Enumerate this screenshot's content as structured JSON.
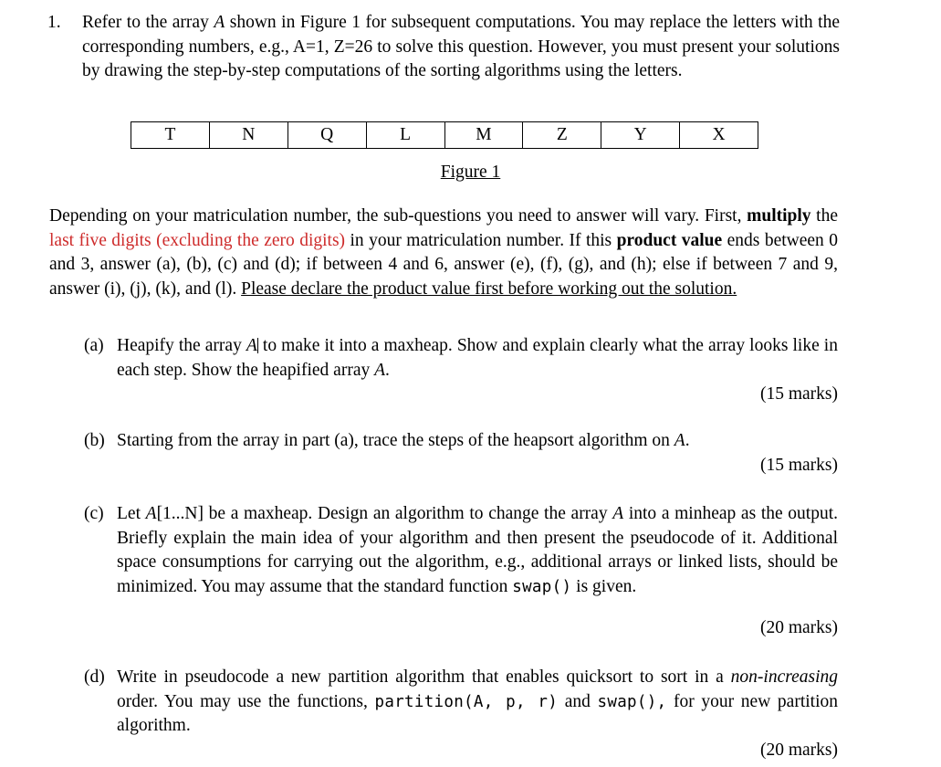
{
  "question": {
    "number": "1.",
    "intro_part1": "Refer to the array ",
    "intro_var": "A",
    "intro_part2": " shown in Figure 1 for subsequent computations. You may replace the letters with the corresponding numbers, e.g., A=1, Z=26 to solve this question. However, you must present your solutions by drawing the step-by-step computations of the sorting algorithms using the letters."
  },
  "figure": {
    "cells": [
      "T",
      "N",
      "Q",
      "L",
      "M",
      "Z",
      "Y",
      "X"
    ],
    "caption": "Figure 1"
  },
  "matriculation": {
    "seg1": "Depending on your matriculation number, the sub-questions you need to answer will vary. First, ",
    "bold1": "multiply",
    "seg2": " the ",
    "red1": "last five digits (excluding the zero digits)",
    "seg3": " in your matriculation number. If this ",
    "bold2": "product value",
    "seg4": " ends between 0 and 3, answer (a), (b), (c) and (d); if between 4 and 6, answer (e), (f), (g), and (h); else if between 7 and 9, answer (i), (j), (k), and (l). ",
    "underlined": "Please declare the product value first before working out the solution."
  },
  "parts": [
    {
      "label": "(a)",
      "seg1": "Heapify the array ",
      "var1": "A",
      "seg2": " to make it into a maxheap. Show and explain clearly what the array looks like in each step. Show the heapified array ",
      "var2": "A",
      "seg3": ".",
      "marks": "(15 marks)"
    },
    {
      "label": "(b)",
      "seg1": "Starting from the array in part (a), trace the steps of the heapsort algorithm on ",
      "var1": "A",
      "seg2": ".",
      "marks": "(15 marks)"
    },
    {
      "label": "(c)",
      "seg1": "Let ",
      "var1": "A",
      "seg2": "[1...N] be a maxheap. Design an algorithm to change the array ",
      "var2": "A",
      "seg3": " into a minheap as the output. Briefly explain the main idea of your algorithm and then present the pseudocode of it. Additional space consumptions for carrying out the algorithm, e.g., additional arrays or linked lists, should be minimized. You may assume that the standard function ",
      "code1": "swap()",
      "seg4": " is given.",
      "marks": "(20 marks)"
    },
    {
      "label": "(d)",
      "seg1": "Write in pseudocode a new partition algorithm that enables quicksort to sort in a ",
      "ital1": "non-increasing",
      "seg2": " order.   You may use the functions, ",
      "code1": "partition(A, p, r)",
      "seg3": " and ",
      "code2": "swap(),",
      "seg4": " for your new partition algorithm.",
      "marks": "(20 marks)"
    }
  ],
  "colors": {
    "red_accent": "#CE2B2B",
    "text": "#000000",
    "background": "#FFFFFF"
  }
}
